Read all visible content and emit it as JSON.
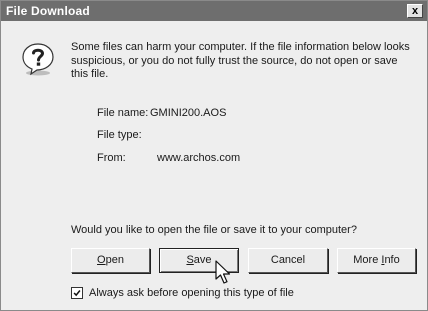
{
  "window": {
    "title": "File Download",
    "close_glyph": "x"
  },
  "message": "Some files can harm your computer. If the file information below looks suspicious, or you do not fully trust the source, do not open or save this file.",
  "file_info": {
    "name_label": "File name:",
    "name_value": "GMINI200.AOS",
    "type_label": "File type:",
    "type_value": "",
    "from_label": "From:",
    "from_value": "www.archos.com"
  },
  "question": "Would you like to open the file or save it to your computer?",
  "buttons": {
    "open": {
      "mnemonic": "O",
      "rest": "pen"
    },
    "save": {
      "mnemonic": "S",
      "rest": "ave"
    },
    "cancel": "Cancel",
    "more_info": {
      "pre": "More ",
      "mnemonic": "I",
      "post": "nfo"
    }
  },
  "checkbox": {
    "checked": true,
    "label": "Always ask before opening this type of file"
  },
  "icons": {
    "dialog": "question-icon",
    "pointer": "mouse-pointer-icon"
  }
}
